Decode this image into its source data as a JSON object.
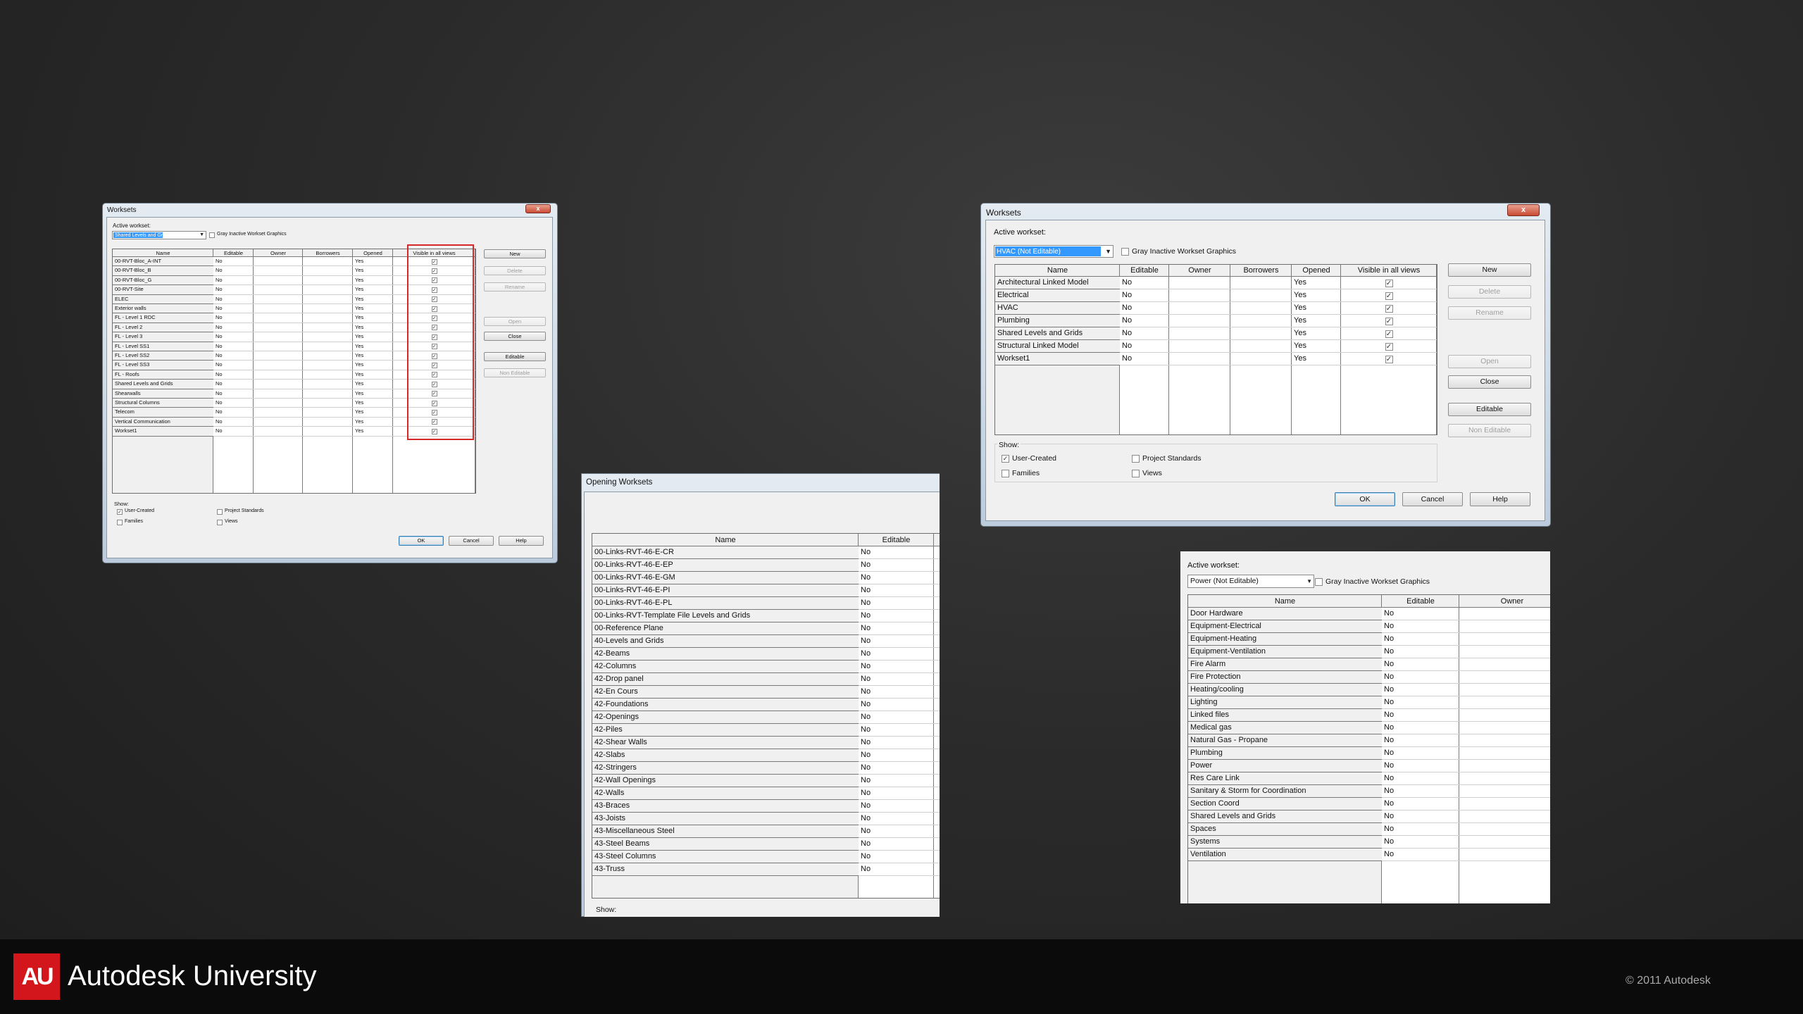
{
  "footer": {
    "logo": "AU",
    "title": "Autodesk University",
    "copyright": "© 2011 Autodesk",
    "brand_color": "#d3161c"
  },
  "d1": {
    "title": "Worksets",
    "close": "x",
    "active_label": "Active workset:",
    "active_value": "Shared Levels and Grids (Not E)",
    "gray_label": "Gray Inactive Workset Graphics",
    "columns": [
      "Name",
      "Editable",
      "Owner",
      "Borrowers",
      "Opened",
      "Visible in all views"
    ],
    "rows": [
      {
        "name": "00-RVT-Bloc_A-INT",
        "editable": "No",
        "opened": "Yes",
        "visible": "✓"
      },
      {
        "name": "00-RVT-Bloc_B",
        "editable": "No",
        "opened": "Yes",
        "visible": "✓"
      },
      {
        "name": "00-RVT-Bloc_G",
        "editable": "No",
        "opened": "Yes",
        "visible": "✓"
      },
      {
        "name": "00-RVT-Site",
        "editable": "No",
        "opened": "Yes",
        "visible": "✓"
      },
      {
        "name": "ELEC",
        "editable": "No",
        "opened": "Yes",
        "visible": "✓"
      },
      {
        "name": "Exterior walls",
        "editable": "No",
        "opened": "Yes",
        "visible": "✓"
      },
      {
        "name": "FL - Level 1 RDC",
        "editable": "No",
        "opened": "Yes",
        "visible": "✓"
      },
      {
        "name": "FL - Level 2",
        "editable": "No",
        "opened": "Yes",
        "visible": "✓"
      },
      {
        "name": "FL - Level 3",
        "editable": "No",
        "opened": "Yes",
        "visible": "✓"
      },
      {
        "name": "FL - Level SS1",
        "editable": "No",
        "opened": "Yes",
        "visible": "✓"
      },
      {
        "name": "FL - Level SS2",
        "editable": "No",
        "opened": "Yes",
        "visible": "✓"
      },
      {
        "name": "FL - Level SS3",
        "editable": "No",
        "opened": "Yes",
        "visible": "✓"
      },
      {
        "name": "FL - Roofs",
        "editable": "No",
        "opened": "Yes",
        "visible": "✓"
      },
      {
        "name": "Shared Levels and Grids",
        "editable": "No",
        "opened": "Yes",
        "visible": "✓"
      },
      {
        "name": "Shearwalls",
        "editable": "No",
        "opened": "Yes",
        "visible": "✓"
      },
      {
        "name": "Structural Columns",
        "editable": "No",
        "opened": "Yes",
        "visible": "✓"
      },
      {
        "name": "Telecom",
        "editable": "No",
        "opened": "Yes",
        "visible": "✓"
      },
      {
        "name": "Vertical Communication",
        "editable": "No",
        "opened": "Yes",
        "visible": "✓"
      },
      {
        "name": "Workset1",
        "editable": "No",
        "opened": "Yes",
        "visible": "✓"
      }
    ],
    "buttons": {
      "new": "New",
      "delete": "Delete",
      "rename": "Rename",
      "open": "Open",
      "close": "Close",
      "editable": "Editable",
      "non_editable": "Non Editable",
      "ok": "OK",
      "cancel": "Cancel",
      "help": "Help"
    },
    "show": {
      "label": "Show:",
      "user_created": "User-Created",
      "families": "Families",
      "project_standards": "Project Standards",
      "views": "Views",
      "user_created_check": "✓"
    }
  },
  "d2": {
    "title": "Worksets",
    "close": "x",
    "active_label": "Active workset:",
    "active_value": "HVAC (Not Editable)",
    "gray_label": "Gray Inactive Workset Graphics",
    "columns": [
      "Name",
      "Editable",
      "Owner",
      "Borrowers",
      "Opened",
      "Visible in all views"
    ],
    "rows": [
      {
        "name": "Architectural Linked Model",
        "editable": "No",
        "opened": "Yes",
        "visible": "✓"
      },
      {
        "name": "Electrical",
        "editable": "No",
        "opened": "Yes",
        "visible": "✓"
      },
      {
        "name": "HVAC",
        "editable": "No",
        "opened": "Yes",
        "visible": "✓"
      },
      {
        "name": "Plumbing",
        "editable": "No",
        "opened": "Yes",
        "visible": "✓"
      },
      {
        "name": "Shared Levels and Grids",
        "editable": "No",
        "opened": "Yes",
        "visible": "✓"
      },
      {
        "name": "Structural Linked Model",
        "editable": "No",
        "opened": "Yes",
        "visible": "✓"
      },
      {
        "name": "Workset1",
        "editable": "No",
        "opened": "Yes",
        "visible": "✓"
      }
    ],
    "buttons": {
      "new": "New",
      "delete": "Delete",
      "rename": "Rename",
      "open": "Open",
      "close": "Close",
      "editable": "Editable",
      "non_editable": "Non Editable",
      "ok": "OK",
      "cancel": "Cancel",
      "help": "Help"
    },
    "show": {
      "label": "Show:",
      "user_created": "User-Created",
      "families": "Families",
      "project_standards": "Project Standards",
      "views": "Views",
      "user_created_check": "✓"
    }
  },
  "d3": {
    "title": "Opening Worksets",
    "columns": [
      "Name",
      "Editable"
    ],
    "rows": [
      {
        "name": "00-Links-RVT-46-E-CR",
        "editable": "No"
      },
      {
        "name": "00-Links-RVT-46-E-EP",
        "editable": "No"
      },
      {
        "name": "00-Links-RVT-46-E-GM",
        "editable": "No"
      },
      {
        "name": "00-Links-RVT-46-E-PI",
        "editable": "No"
      },
      {
        "name": "00-Links-RVT-46-E-PL",
        "editable": "No"
      },
      {
        "name": "00-Links-RVT-Template File Levels and Grids",
        "editable": "No"
      },
      {
        "name": "00-Reference Plane",
        "editable": "No"
      },
      {
        "name": "40-Levels and Grids",
        "editable": "No"
      },
      {
        "name": "42-Beams",
        "editable": "No"
      },
      {
        "name": "42-Columns",
        "editable": "No"
      },
      {
        "name": "42-Drop panel",
        "editable": "No"
      },
      {
        "name": "42-En Cours",
        "editable": "No"
      },
      {
        "name": "42-Foundations",
        "editable": "No"
      },
      {
        "name": "42-Openings",
        "editable": "No"
      },
      {
        "name": "42-Piles",
        "editable": "No"
      },
      {
        "name": "42-Shear Walls",
        "editable": "No"
      },
      {
        "name": "42-Slabs",
        "editable": "No"
      },
      {
        "name": "42-Stringers",
        "editable": "No"
      },
      {
        "name": "42-Wall Openings",
        "editable": "No"
      },
      {
        "name": "42-Walls",
        "editable": "No"
      },
      {
        "name": "43-Braces",
        "editable": "No"
      },
      {
        "name": "43-Joists",
        "editable": "No"
      },
      {
        "name": "43-Miscellaneous Steel",
        "editable": "No"
      },
      {
        "name": "43-Steel Beams",
        "editable": "No"
      },
      {
        "name": "43-Steel Columns",
        "editable": "No"
      },
      {
        "name": "43-Truss",
        "editable": "No"
      }
    ],
    "show_label": "Show:"
  },
  "d4": {
    "active_label": "Active workset:",
    "active_value": "Power (Not Editable)",
    "gray_label": "Gray Inactive Workset Graphics",
    "columns": [
      "Name",
      "Editable",
      "Owner"
    ],
    "rows": [
      {
        "name": "Door Hardware",
        "editable": "No"
      },
      {
        "name": "Equipment-Electrical",
        "editable": "No"
      },
      {
        "name": "Equipment-Heating",
        "editable": "No"
      },
      {
        "name": "Equipment-Ventilation",
        "editable": "No"
      },
      {
        "name": "Fire Alarm",
        "editable": "No"
      },
      {
        "name": "Fire Protection",
        "editable": "No"
      },
      {
        "name": "Heating/cooling",
        "editable": "No"
      },
      {
        "name": "Lighting",
        "editable": "No"
      },
      {
        "name": "Linked files",
        "editable": "No"
      },
      {
        "name": "Medical gas",
        "editable": "No"
      },
      {
        "name": "Natural Gas - Propane",
        "editable": "No"
      },
      {
        "name": "Plumbing",
        "editable": "No"
      },
      {
        "name": "Power",
        "editable": "No"
      },
      {
        "name": "Res Care Link",
        "editable": "No"
      },
      {
        "name": "Sanitary & Storm for Coordination",
        "editable": "No"
      },
      {
        "name": "Section Coord",
        "editable": "No"
      },
      {
        "name": "Shared Levels and Grids",
        "editable": "No"
      },
      {
        "name": "Spaces",
        "editable": "No"
      },
      {
        "name": "Systems",
        "editable": "No"
      },
      {
        "name": "Ventilation",
        "editable": "No"
      }
    ]
  }
}
